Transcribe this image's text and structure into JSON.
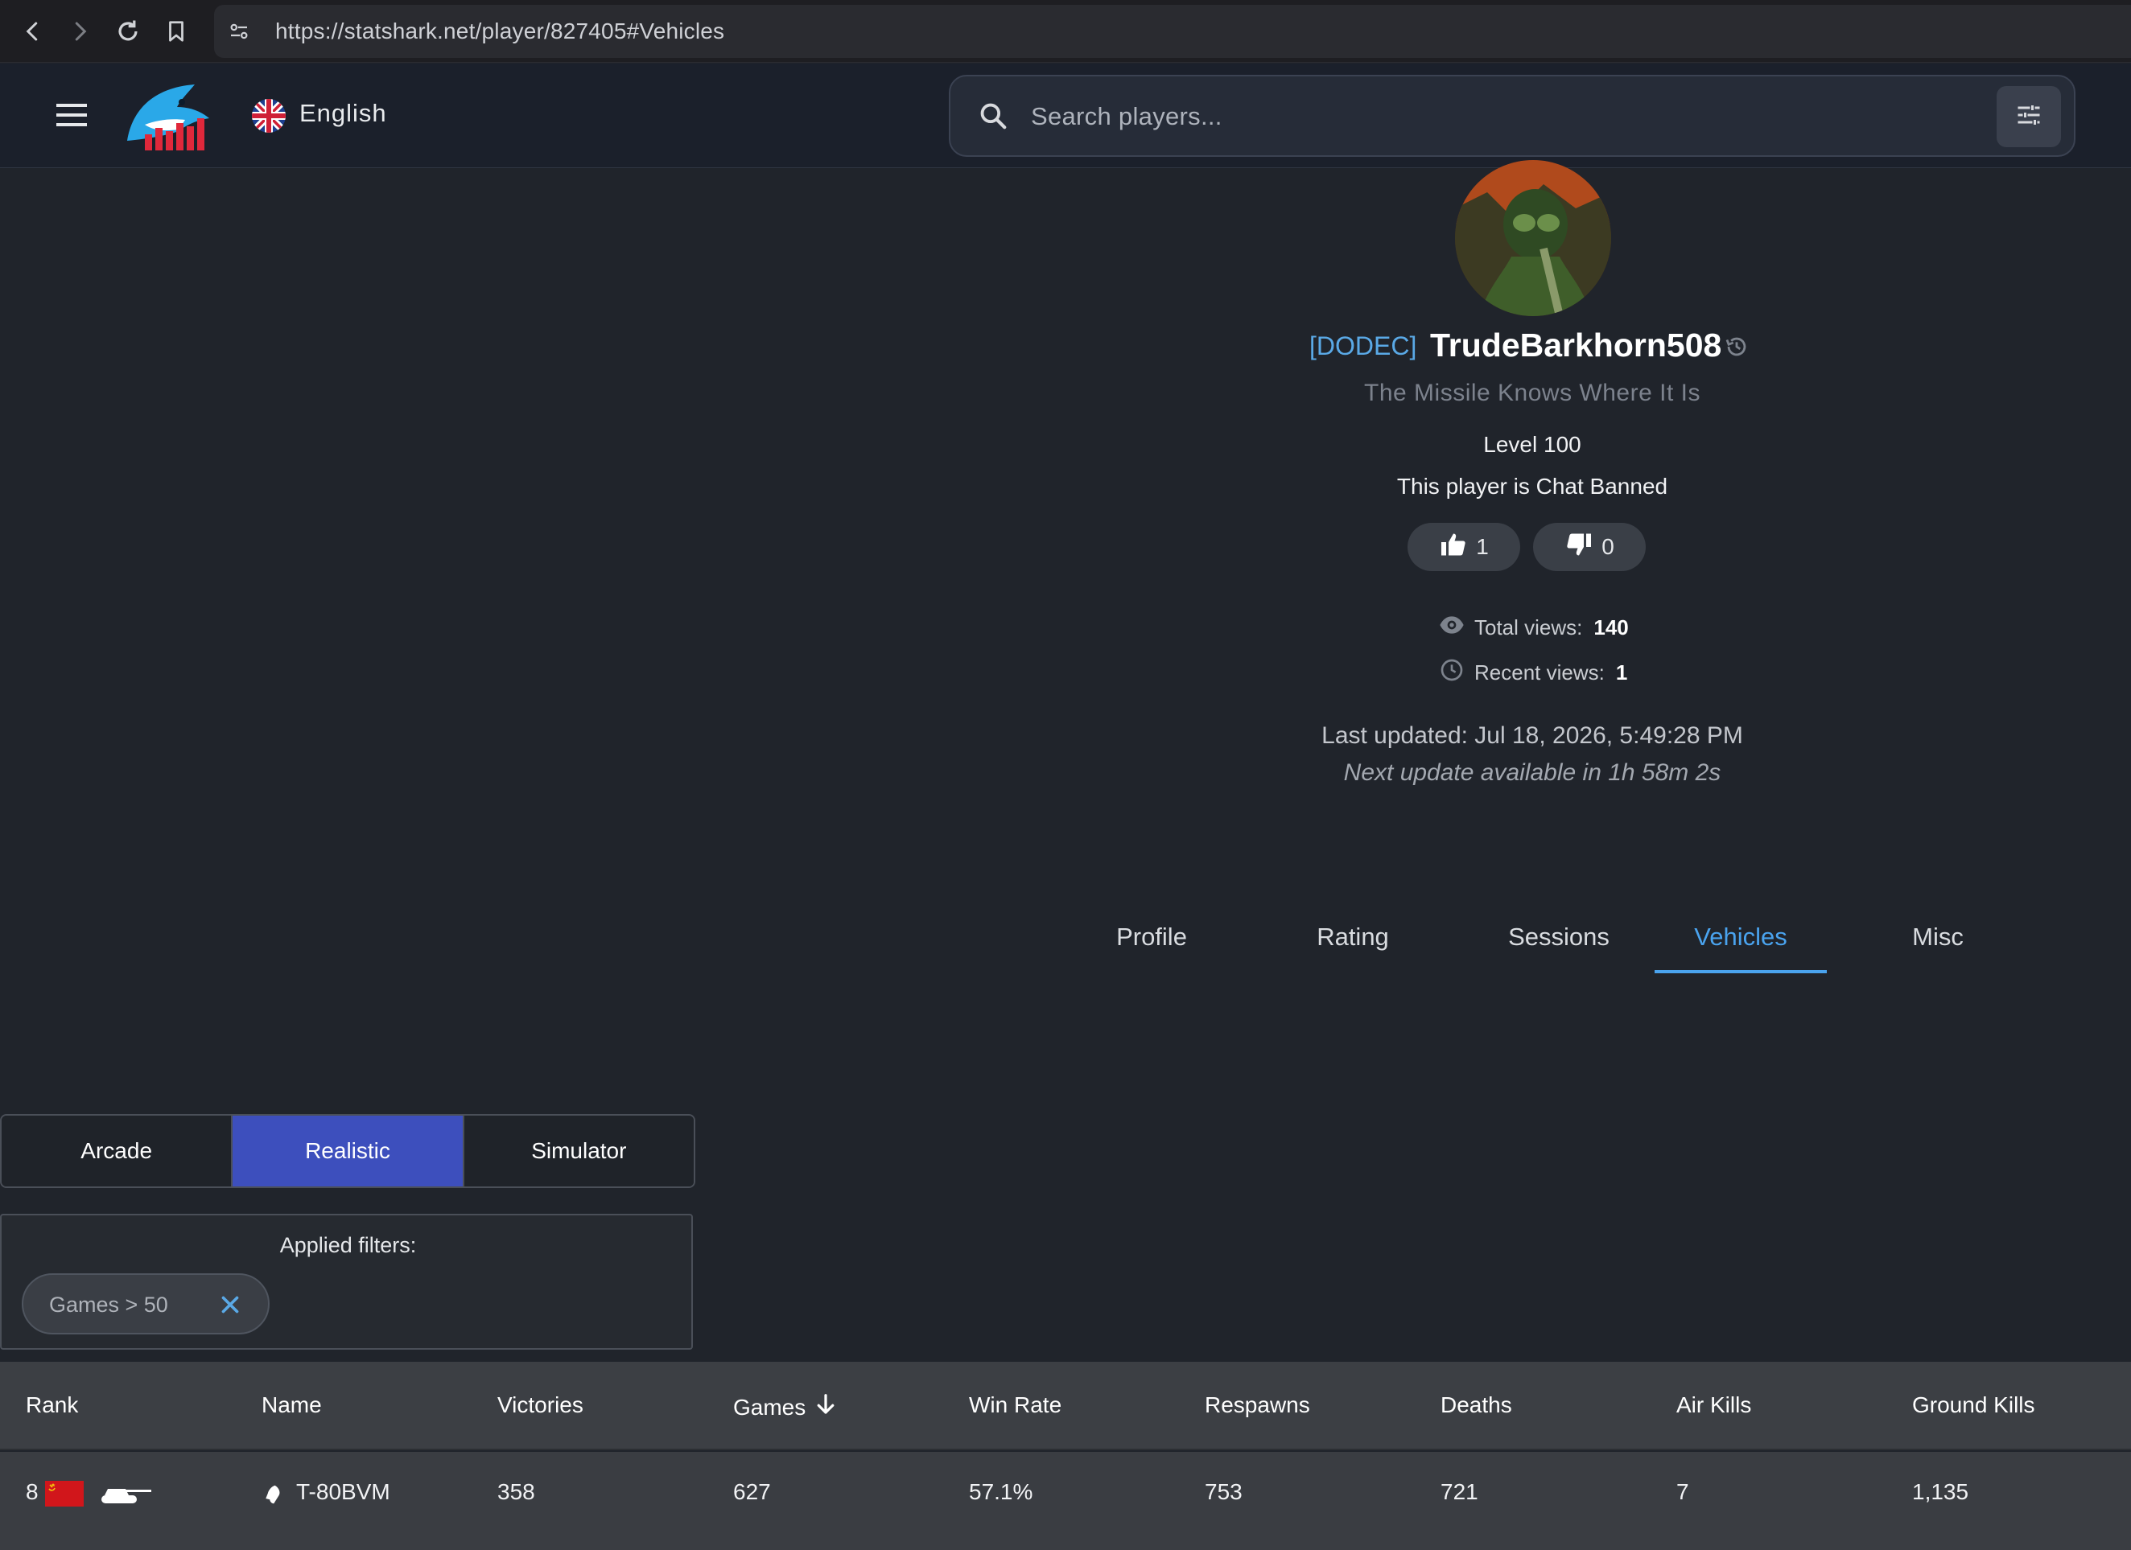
{
  "browser": {
    "url": "https://statshark.net/player/827405#Vehicles"
  },
  "appbar": {
    "language": "English",
    "search_placeholder": "Search players..."
  },
  "player": {
    "clan": "[DODEC]",
    "name": "TrudeBarkhorn508",
    "title": "The Missile Knows Where It Is",
    "level": "Level 100",
    "chat_status": "This player is Chat Banned",
    "likes": "1",
    "dislikes": "0",
    "total_views_label": "Total views:",
    "total_views": "140",
    "recent_views_label": "Recent views:",
    "recent_views": "1",
    "last_updated": "Last updated: Jul 18, 2026, 5:49:28 PM",
    "next_update": "Next update available in 1h 58m 2s"
  },
  "tabs": [
    {
      "label": "Profile"
    },
    {
      "label": "Rating"
    },
    {
      "label": "Sessions"
    },
    {
      "label": "Vehicles",
      "active": true
    },
    {
      "label": "Misc"
    }
  ],
  "modes": [
    {
      "label": "Arcade"
    },
    {
      "label": "Realistic",
      "active": true
    },
    {
      "label": "Simulator"
    }
  ],
  "filters": {
    "title": "Applied filters:",
    "chips": [
      {
        "label": "Games > 50"
      }
    ]
  },
  "table": {
    "headers": [
      "Rank",
      "Name",
      "Victories",
      "Games",
      "Win Rate",
      "Respawns",
      "Deaths",
      "Air Kills",
      "Ground Kills"
    ],
    "sorted_column": "Games",
    "sort_direction": "descending",
    "rows": [
      {
        "rank": "8",
        "nation": "ussr-flag-icon",
        "vehicle_type": "tank-icon",
        "name": "T-80BVM",
        "victories": "358",
        "games": "627",
        "win_rate": "57.1%",
        "respawns": "753",
        "deaths": "721",
        "air_kills": "7",
        "ground_kills": "1,135"
      }
    ]
  },
  "colors": {
    "accent": "#4aa3ee",
    "mode_active": "#3d4fbd",
    "clan": "#5aa9e6",
    "background": "#20242b"
  }
}
